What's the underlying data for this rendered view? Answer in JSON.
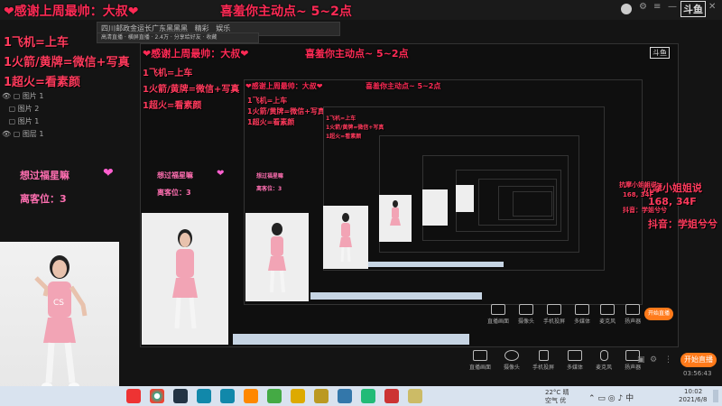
{
  "window": {
    "app_logo": "斗鱼",
    "minimize": "—",
    "close": "✕"
  },
  "banner": {
    "left": "❤感谢上周最帅：大叔❤",
    "right": "喜羞你主动点~   5~2点"
  },
  "notes": {
    "line1": "1飞机=上车",
    "line2": "1火箭/黄牌=微信+写真",
    "line3": "1超火=看素颜"
  },
  "wish": {
    "text": "想过福星嘛",
    "heart": "❤",
    "seat": "离客位：3"
  },
  "right_info": {
    "line1": "抗摩小姐姐说",
    "line2": "168, 34F",
    "line3": "抖音：学姐兮兮"
  },
  "app_strip": {
    "title": "四川邮政金运长广东黑黑黑",
    "tab1": "精彩",
    "tab2": "娱乐",
    "search": "直播间管理",
    "row2": "高清直播 · 横屏直播 · 2.4万 · 分享给好友 · 收藏"
  },
  "layers": [
    {
      "label": "图片 1"
    },
    {
      "label": "图片 2"
    },
    {
      "label": "图片 1"
    },
    {
      "label": "图层 1"
    }
  ],
  "bottom_toolbar": {
    "items": [
      {
        "label": "直播画面",
        "icon": "screen-icon"
      },
      {
        "label": "摄像头",
        "icon": "camera-icon"
      },
      {
        "label": "手机投屏",
        "icon": "phone-cast-icon"
      },
      {
        "label": "多媒体",
        "icon": "media-icon"
      },
      {
        "label": "麦克风",
        "icon": "mic-icon"
      },
      {
        "label": "扬声器",
        "icon": "speaker-icon"
      }
    ],
    "start_live": "开始直播",
    "timer": "03:56:43"
  },
  "taskbar": {
    "weather": "22°C 晴",
    "weather_sub": "空气 优",
    "time": "10:02",
    "date": "2021/6/8",
    "apps": [
      {
        "name": "netease-music",
        "color": "#e33"
      },
      {
        "name": "chrome",
        "color": "#3a8"
      },
      {
        "name": "steam",
        "color": "#234"
      },
      {
        "name": "app-blue",
        "color": "#18a"
      },
      {
        "name": "app-help",
        "color": "#f80"
      },
      {
        "name": "player",
        "color": "#4a4"
      },
      {
        "name": "app-yellow",
        "color": "#da0"
      },
      {
        "name": "lol",
        "color": "#b92"
      },
      {
        "name": "app-lol2",
        "color": "#37a"
      },
      {
        "name": "app-gem",
        "color": "#2b7"
      },
      {
        "name": "app-red",
        "color": "#c33"
      },
      {
        "name": "app-folder",
        "color": "#cb6"
      }
    ]
  },
  "colors": {
    "accent_pink": "#ff2a55",
    "start_live": "#ff7a1a",
    "background": "#141414"
  }
}
